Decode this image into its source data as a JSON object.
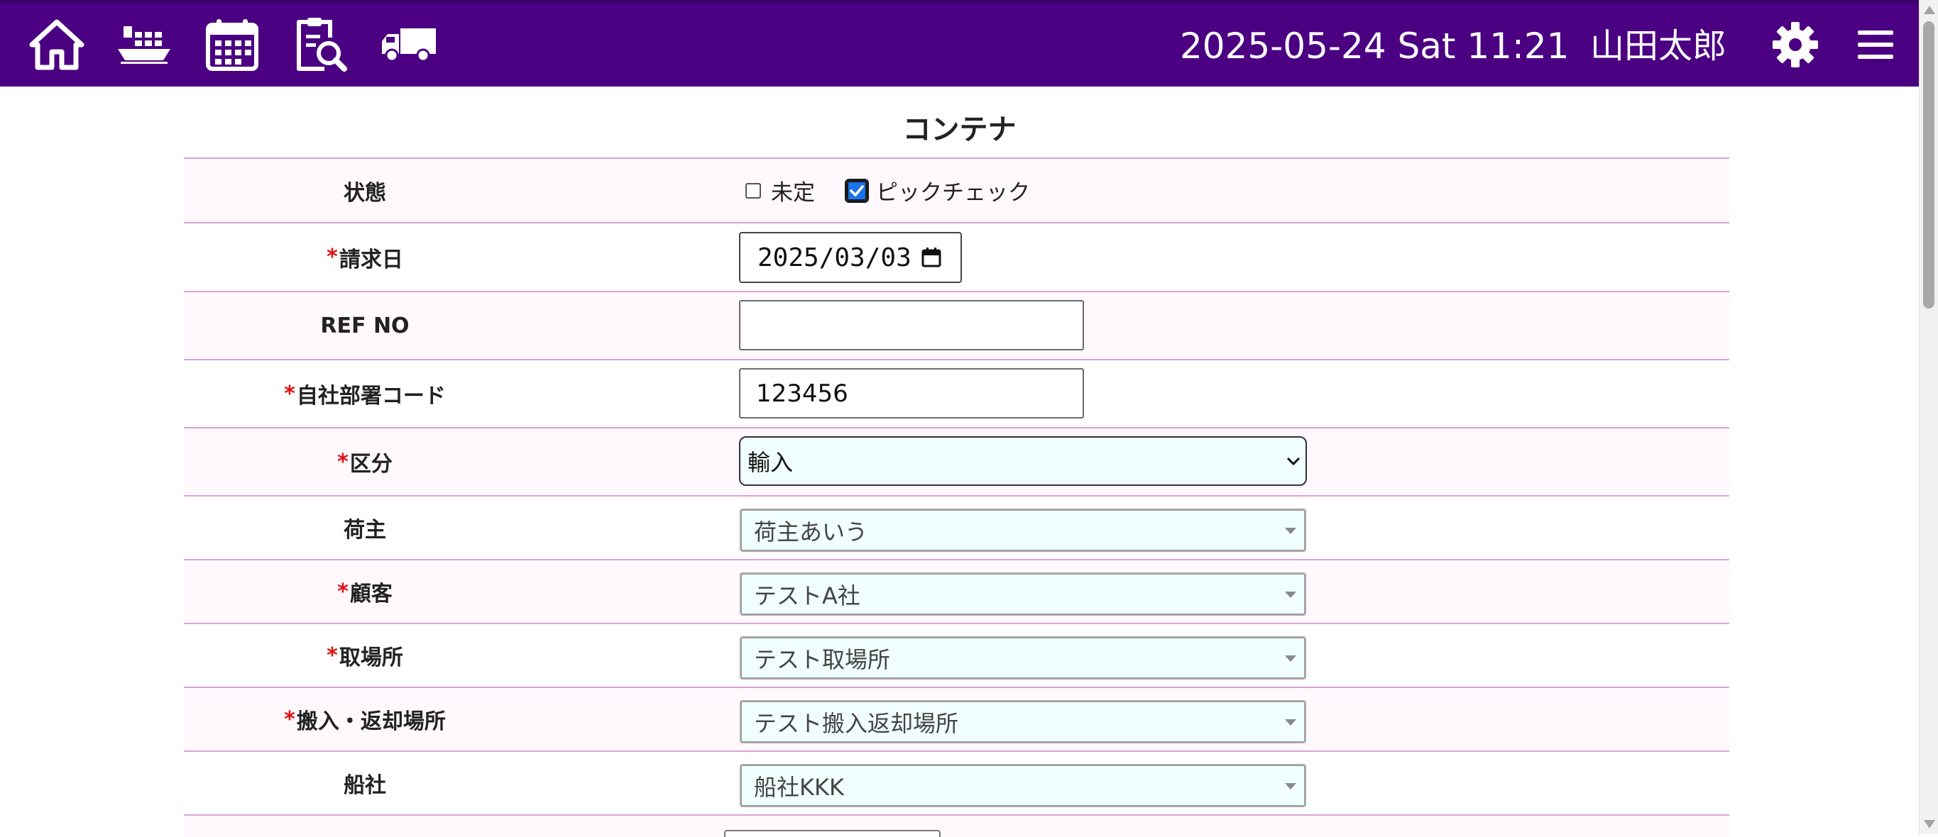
{
  "header": {
    "nav_icons": [
      "home-icon",
      "ship-icon",
      "calendar-icon",
      "document-search-icon",
      "truck-icon"
    ],
    "datetime": "2025-05-24 Sat 11:21",
    "user_name": "山田太郎",
    "settings_icon": "gear-icon",
    "menu_icon": "hamburger-menu-icon",
    "bar_color": "#4b0082"
  },
  "page": {
    "title": "コンテナ"
  },
  "form": {
    "status": {
      "label": "状態",
      "options": [
        {
          "label": "未定",
          "checked": false
        },
        {
          "label": "ピックチェック",
          "checked": true
        }
      ]
    },
    "billing_date": {
      "required": "*",
      "label": "請求日",
      "value": "2025/03/03"
    },
    "ref_no": {
      "label": "REF NO",
      "value": ""
    },
    "dept_code": {
      "required": "*",
      "label": "自社部署コード",
      "value": "123456"
    },
    "category": {
      "required": "*",
      "label": "区分",
      "value": "輸入"
    },
    "shipper": {
      "label": "荷主",
      "value": "荷主あいう"
    },
    "customer": {
      "required": "*",
      "label": "顧客",
      "value": "テストA社"
    },
    "pickup_place": {
      "required": "*",
      "label": "取場所",
      "value": "テスト取場所"
    },
    "return_place": {
      "required": "*",
      "label": "搬入・返却場所",
      "value": "テスト搬入返却場所"
    },
    "shipping_company": {
      "label": "船社",
      "value": "船社KKK"
    }
  },
  "colors": {
    "accent": "#4b0082",
    "required": "#e01010",
    "row_border": "#d9a3d9",
    "select_bg": "#f0fffd"
  }
}
